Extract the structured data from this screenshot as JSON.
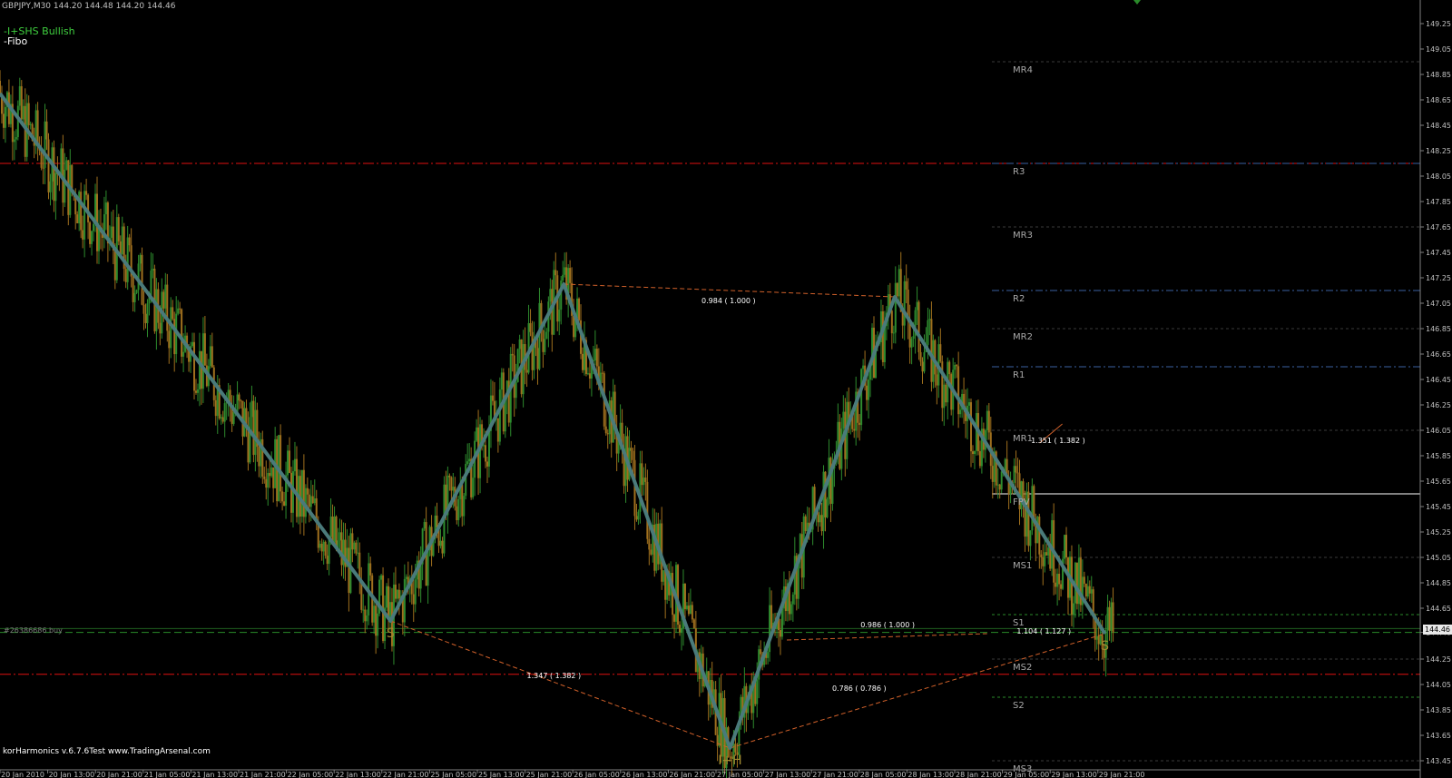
{
  "header": {
    "symbol_info": "GBPJPY,M30  144.20 144.48 144.20 144.46"
  },
  "indicators": [
    "-I+SHS Bullish",
    "-Fibo"
  ],
  "order_label": "#26386686 buy",
  "footer": "korHarmonics v.6.7.6Test www.TradingArsenal.com",
  "current_price": "144.46",
  "colors": {
    "background": "#000000",
    "pattern": "#4a7a7a",
    "candle_up": "#2e8b2e",
    "candle_down": "#a0701e",
    "fib_line": "#d0602a",
    "red_level": "#e01010",
    "blue_level": "#3a5fa0",
    "green_level": "#2a8a2a",
    "pivot": "#ffffff",
    "marker": "#a08a30"
  },
  "chart_data": {
    "type": "line",
    "title": "",
    "xlabel": "",
    "ylabel": "",
    "ylim": [
      143.4,
      149.4
    ],
    "y_ticks": [
      "149.25",
      "149.05",
      "148.85",
      "148.65",
      "148.45",
      "148.25",
      "148.05",
      "147.85",
      "147.65",
      "147.45",
      "147.25",
      "147.05",
      "146.85",
      "146.65",
      "146.45",
      "146.25",
      "146.05",
      "145.85",
      "145.65",
      "145.45",
      "145.25",
      "145.05",
      "144.85",
      "144.65",
      "144.46",
      "144.25",
      "144.05",
      "143.85",
      "143.65",
      "143.45"
    ],
    "x_ticks": [
      "20 Jan 2010",
      "20 Jan 13:00",
      "20 Jan 21:00",
      "21 Jan 05:00",
      "21 Jan 13:00",
      "21 Jan 21:00",
      "22 Jan 05:00",
      "22 Jan 13:00",
      "22 Jan 21:00",
      "25 Jan 05:00",
      "25 Jan 13:00",
      "25 Jan 21:00",
      "26 Jan 05:00",
      "26 Jan 13:00",
      "26 Jan 21:00",
      "27 Jan 05:00",
      "27 Jan 13:00",
      "27 Jan 21:00",
      "28 Jan 05:00",
      "28 Jan 13:00",
      "28 Jan 21:00",
      "29 Jan 05:00",
      "29 Jan 13:00",
      "29 Jan 21:00"
    ],
    "pattern_points": [
      {
        "x": 0,
        "y": 148.7
      },
      {
        "x": 0.275,
        "y": 144.55,
        "label": "S"
      },
      {
        "x": 0.397,
        "y": 147.2
      },
      {
        "x": 0.514,
        "y": 143.55,
        "label": "I+H"
      },
      {
        "x": 0.63,
        "y": 147.1
      },
      {
        "x": 0.778,
        "y": 144.45,
        "label": "S"
      }
    ],
    "fib_labels": [
      {
        "text": "0.984 ( 1.000 )",
        "x": 0.513,
        "y": 147.05
      },
      {
        "text": "1.347 ( 1.382 )",
        "x": 0.39,
        "y": 144.1
      },
      {
        "text": "0.786 ( 0.786 )",
        "x": 0.605,
        "y": 144.0
      },
      {
        "text": "0.986 ( 1.000 )",
        "x": 0.625,
        "y": 144.5
      },
      {
        "text": "1.104 ( 1.127 )",
        "x": 0.735,
        "y": 144.45
      },
      {
        "text": "1.351 ( 1.382 )",
        "x": 0.745,
        "y": 145.95
      }
    ],
    "pivot_levels": [
      {
        "name": "MR4",
        "value": 148.95,
        "style": "grey"
      },
      {
        "name": "R3",
        "value": 148.15,
        "style": "blue"
      },
      {
        "name": "MR3",
        "value": 147.65,
        "style": "grey"
      },
      {
        "name": "R2",
        "value": 147.15,
        "style": "blue"
      },
      {
        "name": "MR2",
        "value": 146.85,
        "style": "grey"
      },
      {
        "name": "R1",
        "value": 146.55,
        "style": "blue"
      },
      {
        "name": "MR1",
        "value": 146.05,
        "style": "grey"
      },
      {
        "name": "FPV",
        "value": 145.55,
        "style": "white"
      },
      {
        "name": "MS1",
        "value": 145.05,
        "style": "grey"
      },
      {
        "name": "S1",
        "value": 144.6,
        "style": "green"
      },
      {
        "name": "MS2",
        "value": 144.25,
        "style": "grey"
      },
      {
        "name": "S2",
        "value": 143.95,
        "style": "green"
      },
      {
        "name": "MS3",
        "value": 143.45,
        "style": "grey"
      }
    ],
    "horizontal_lines": [
      {
        "value": 148.15,
        "style": "red"
      },
      {
        "value": 144.13,
        "style": "red"
      },
      {
        "value": 144.46,
        "style": "green-dash"
      },
      {
        "value": 144.49,
        "style": "green-solid"
      }
    ]
  }
}
